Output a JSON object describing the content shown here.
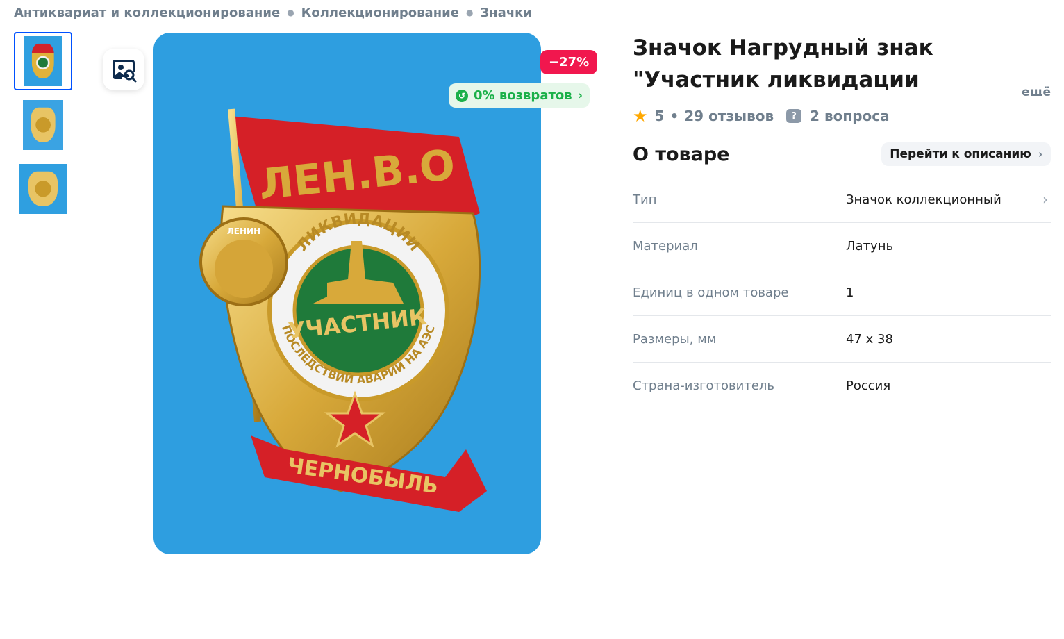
{
  "breadcrumb": [
    "Антиквариат и коллекционирование",
    "Коллекционирование",
    "Значки"
  ],
  "badges": {
    "discount": "−27%",
    "returns": "0% возвратов"
  },
  "product": {
    "title": "Значок Нагрудный знак \"Участник ликвидации последствий аварии",
    "title_more": "ещё",
    "rating": "5",
    "reviews": "29 отзывов",
    "questions": "2 вопроса"
  },
  "about": {
    "heading": "О товаре",
    "goto_label": "Перейти к описанию",
    "properties": [
      {
        "key": "Тип",
        "value": "Значок коллекционный"
      },
      {
        "key": "Материал",
        "value": "Латунь"
      },
      {
        "key": "Единиц в одном товаре",
        "value": "1"
      },
      {
        "key": "Размеры, мм",
        "value": "47 x 38"
      },
      {
        "key": "Страна-изготовитель",
        "value": "Россия"
      }
    ]
  },
  "photo_text": {
    "top": "ЛЕН.В.О",
    "ring_top": "ЛИКВИДАЦИИ",
    "center": "УЧАСТНИК",
    "ring_bottom": "ПОСЛЕДСТВИЙ АВАРИИ НА АЭС",
    "bottom": "ЧЕРНОБЫЛЬ",
    "medal": "ЛЕНИН"
  },
  "colors": {
    "accent": "#0051ff",
    "discount": "#f1174e",
    "returns": "#1bb049",
    "star": "#ffa800",
    "photo_bg": "#2e9ee0"
  },
  "icons": {
    "zoom": "image-search-icon",
    "star": "star-icon",
    "question": "question-icon",
    "chevron": "chevron-right-icon"
  }
}
